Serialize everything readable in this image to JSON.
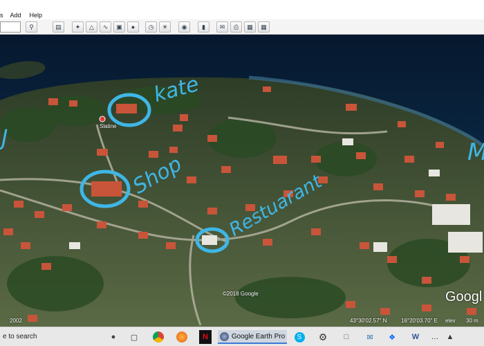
{
  "menu": {
    "items": [
      "s",
      "Add",
      "Help"
    ]
  },
  "map": {
    "place_label": "Slatine",
    "annotations": {
      "kate": "kate",
      "shop": "Shop",
      "restaurant": "Restuarant",
      "left_edge": "J",
      "right_edge": "M"
    },
    "copyright": "©2018 Google",
    "brand": "Googl",
    "status": {
      "year": "2002",
      "latitude": "43°30'02.57\" N",
      "longitude": "16°20'03.70\" E",
      "elev": "elev",
      "altitude": "30 m"
    }
  },
  "taskbar": {
    "search_text": "e to search",
    "app_label": "Google Earth Pro"
  },
  "colors": {
    "sea": "#0a2440",
    "annotation": "#3fb6e6",
    "roof": "#c8553a"
  }
}
